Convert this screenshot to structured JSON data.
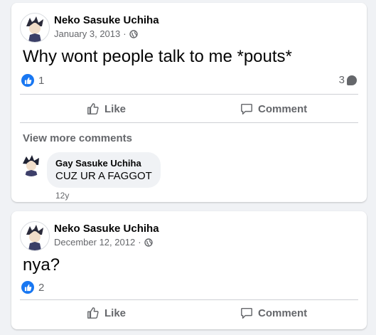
{
  "posts": [
    {
      "author": "Neko Sasuke Uchiha",
      "date": "January 3, 2013",
      "separator": "·",
      "text": "Why wont people talk to me *pouts*",
      "like_count": "1",
      "comment_count": "3",
      "actions": {
        "like": "Like",
        "comment": "Comment"
      },
      "view_more": "View more comments",
      "comment": {
        "author": "Gay Sasuke Uchiha",
        "text": "CUZ UR A FAGGOT",
        "time": "12y"
      }
    },
    {
      "author": "Neko Sasuke Uchiha",
      "date": "December 12, 2012",
      "separator": "·",
      "text": "nya?",
      "like_count": "2",
      "actions": {
        "like": "Like",
        "comment": "Comment"
      }
    }
  ],
  "icons": {
    "audience": "globe-icon",
    "like_reaction": "thumbs-up-icon",
    "comment": "speech-bubble-icon"
  },
  "colors": {
    "brand": "#1877f2",
    "secondary_text": "#65676b",
    "background": "#f0f2f5"
  }
}
